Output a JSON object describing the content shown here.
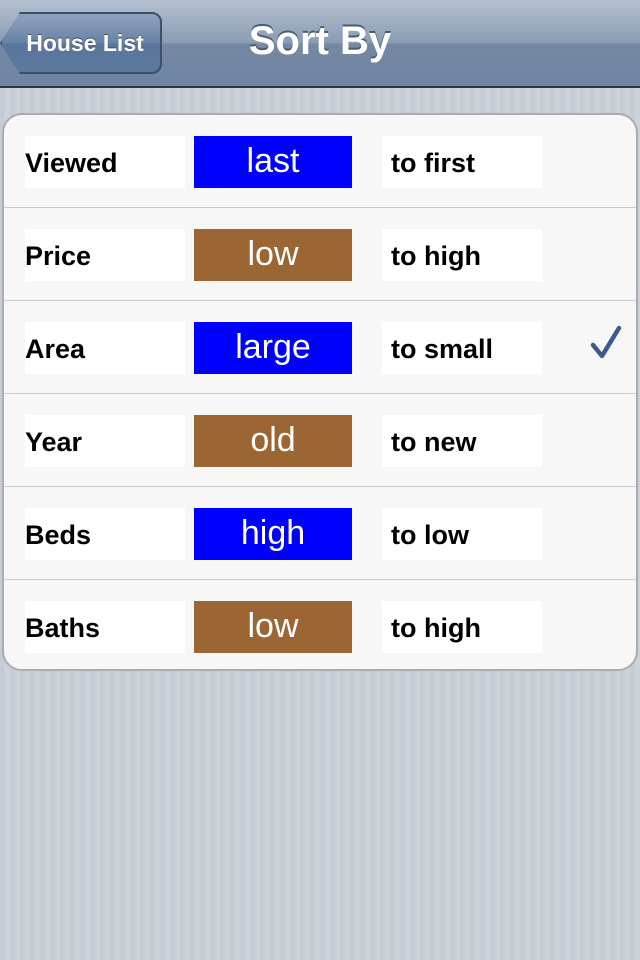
{
  "nav": {
    "back_label": "House List",
    "title": "Sort By"
  },
  "colors": {
    "blue_pill": "#0000ff",
    "brown_pill": "#9b6633",
    "checkmark": "#3c5a8f"
  },
  "rows": [
    {
      "label": "Viewed",
      "value": "last",
      "suffix": "to first",
      "pill_color": "blue",
      "selected": false
    },
    {
      "label": "Price",
      "value": "low",
      "suffix": "to high",
      "pill_color": "brown",
      "selected": false
    },
    {
      "label": "Area",
      "value": "large",
      "suffix": "to small",
      "pill_color": "blue",
      "selected": true
    },
    {
      "label": "Year",
      "value": "old",
      "suffix": "to new",
      "pill_color": "brown",
      "selected": false
    },
    {
      "label": "Beds",
      "value": "high",
      "suffix": "to low",
      "pill_color": "blue",
      "selected": false
    },
    {
      "label": "Baths",
      "value": "low",
      "suffix": "to high",
      "pill_color": "brown",
      "selected": false
    }
  ]
}
